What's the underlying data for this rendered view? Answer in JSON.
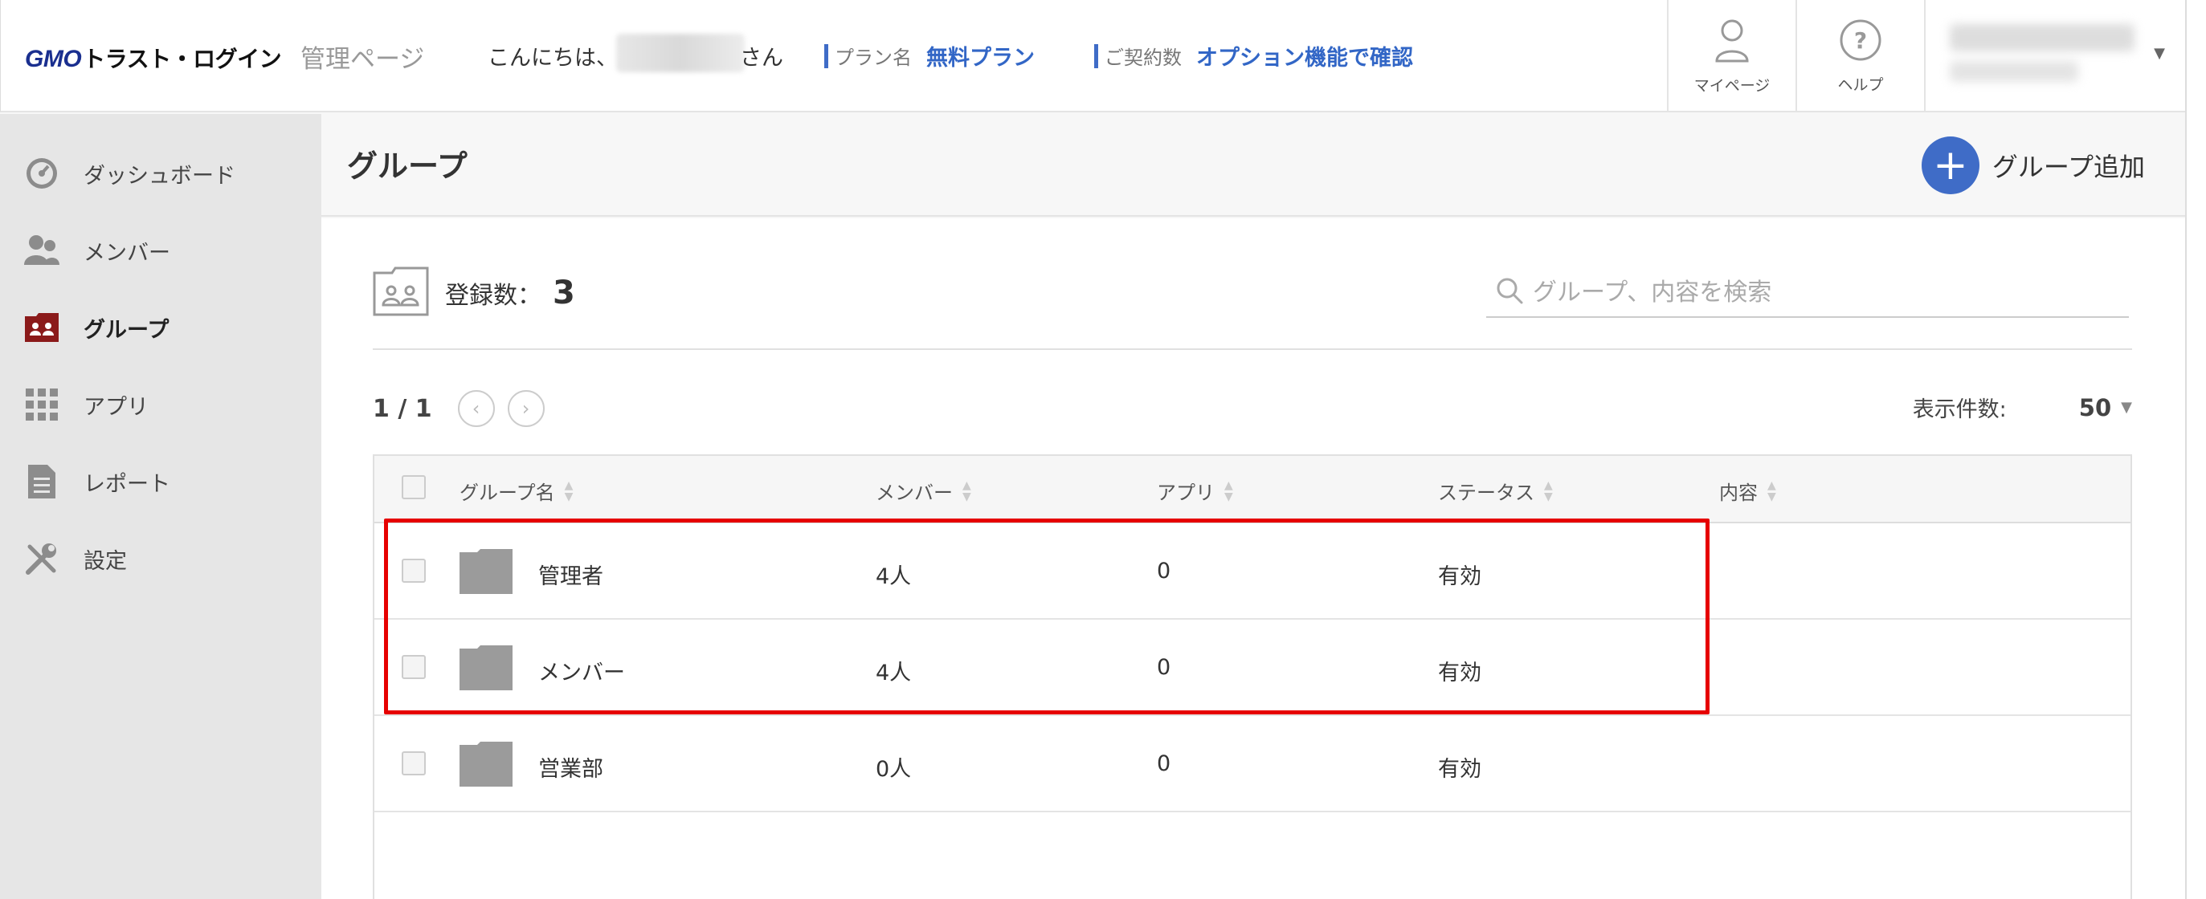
{
  "header": {
    "logo_gmo": "GMO",
    "logo_text": "トラスト・ログイン",
    "admin_label": "管理ページ",
    "greeting": "こんにちは、",
    "greeting_suffix": "さん",
    "plan_key": "プラン名",
    "plan_value": "無料プラン",
    "contract_key": "ご契約数",
    "contract_value": "オプション機能で確認",
    "mypage_label": "マイページ",
    "help_label": "ヘルプ"
  },
  "sidebar": {
    "items": [
      {
        "label": "ダッシュボード",
        "icon": "dashboard-icon"
      },
      {
        "label": "メンバー",
        "icon": "members-icon"
      },
      {
        "label": "グループ",
        "icon": "group-icon",
        "active": true
      },
      {
        "label": "アプリ",
        "icon": "apps-grid-icon"
      },
      {
        "label": "レポート",
        "icon": "report-icon"
      },
      {
        "label": "設定",
        "icon": "settings-tools-icon"
      }
    ]
  },
  "main": {
    "title": "グループ",
    "add_button": "グループ追加",
    "count_label": "登録数：",
    "count_value": "3",
    "search_placeholder": "グループ、内容を検索",
    "pager_text": "1 / 1",
    "per_page_label": "表示件数:",
    "per_page_value": "50"
  },
  "table": {
    "columns": [
      "グループ名",
      "メンバー",
      "アプリ",
      "ステータス",
      "内容"
    ],
    "rows": [
      {
        "name": "管理者",
        "members": "4人",
        "apps": "0",
        "status": "有効",
        "content": ""
      },
      {
        "name": "メンバー",
        "members": "4人",
        "apps": "0",
        "status": "有効",
        "content": ""
      },
      {
        "name": "営業部",
        "members": "0人",
        "apps": "0",
        "status": "有効",
        "content": ""
      }
    ]
  },
  "colors": {
    "accent": "#3f6cc7",
    "highlight": "#e60000",
    "active_icon": "#8b1a1a"
  }
}
